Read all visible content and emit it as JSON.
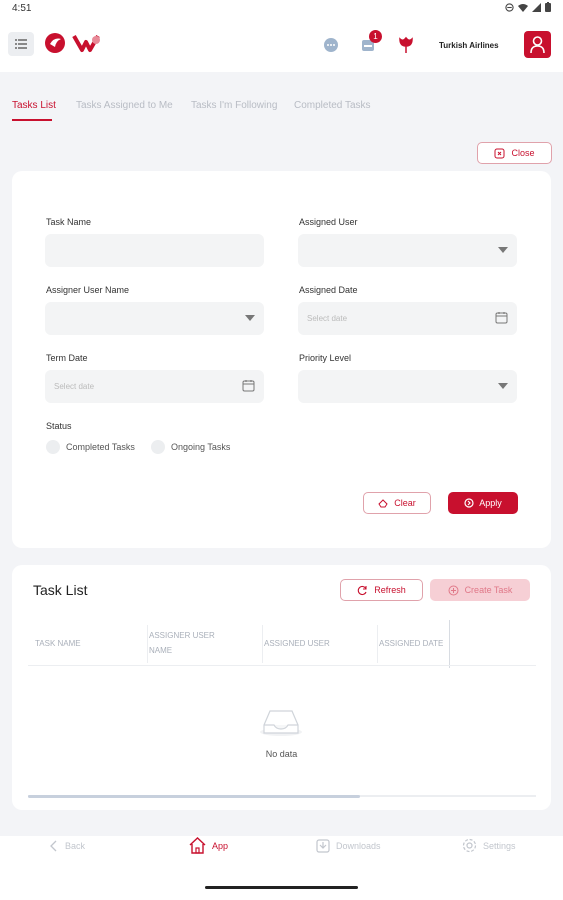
{
  "status_bar": {
    "time": "4:51"
  },
  "header": {
    "company": "Turkish Airlines",
    "notification_count": "1"
  },
  "tabs": [
    {
      "label": "Tasks List",
      "active": true
    },
    {
      "label": "Tasks Assigned to Me",
      "active": false
    },
    {
      "label": "Tasks I'm Following",
      "active": false
    },
    {
      "label": "Completed Tasks",
      "active": false
    }
  ],
  "close_label": "Close",
  "filters": {
    "task_name_label": "Task Name",
    "assigned_user_label": "Assigned User",
    "assigner_user_name_label": "Assigner User Name",
    "assigned_date_label": "Assigned Date",
    "assigned_date_placeholder": "Select date",
    "term_date_label": "Term Date",
    "term_date_placeholder": "Select date",
    "priority_label": "Priority Level",
    "status_label": "Status",
    "status_options": [
      "Completed Tasks",
      "Ongoing Tasks"
    ],
    "clear_label": "Clear",
    "apply_label": "Apply"
  },
  "task_list": {
    "title": "Task List",
    "refresh_label": "Refresh",
    "create_label": "Create Task",
    "columns": [
      "TASK NAME",
      "ASSIGNER USER NAME",
      "ASSIGNED USER",
      "ASSIGNED DATE"
    ],
    "empty_text": "No data"
  },
  "bottom_nav": [
    {
      "label": "Back",
      "icon": "chevron-left-icon"
    },
    {
      "label": "App",
      "icon": "home-icon"
    },
    {
      "label": "Downloads",
      "icon": "download-icon"
    },
    {
      "label": "Settings",
      "icon": "gear-icon"
    }
  ],
  "colors": {
    "brand": "#c8102e",
    "background": "#f3f4f7",
    "muted": "#b8bcc4"
  }
}
